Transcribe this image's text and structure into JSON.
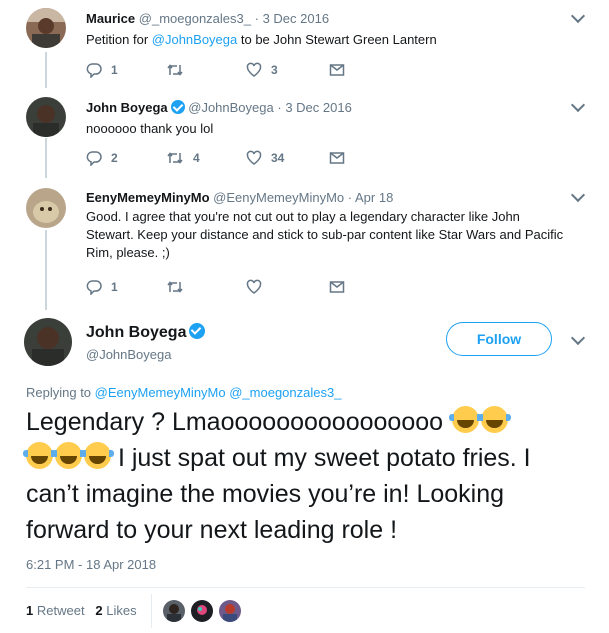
{
  "thread": [
    {
      "name": "Maurice",
      "handle": "@_moegonzales3_",
      "dot": "·",
      "date": "3 Dec 2016",
      "verified": false,
      "text_prefix": "Petition for ",
      "text_mention": "@JohnBoyega",
      "text_suffix": " to be John Stewart Green Lantern",
      "replies": "1",
      "retweets": "",
      "likes": "3"
    },
    {
      "name": "John Boyega",
      "handle": "@JohnBoyega",
      "dot": "·",
      "date": "3 Dec 2016",
      "verified": true,
      "text": "noooooo thank you lol",
      "replies": "2",
      "retweets": "4",
      "likes": "34"
    },
    {
      "name": "EenyMemeyMinyMo",
      "handle": "@EenyMemeyMinyMo",
      "dot": "·",
      "date": "Apr 18",
      "verified": false,
      "text": "Good.  I agree that you're not cut out to play a legendary character like John Stewart.  Keep your distance and stick to sub-par content like Star Wars and Pacific Rim, please.  ;)",
      "replies": "1",
      "retweets": "",
      "likes": ""
    }
  ],
  "main_tweet": {
    "name": "John Boyega",
    "handle": "@JohnBoyega",
    "follow_label": "Follow",
    "replying_prefix": "Replying to ",
    "replying_to_1": "@EenyMemeyMinyMo",
    "replying_to_2": "@_moegonzales3_",
    "text_line1": "Legendary ? Lmaoooooooooooooooo",
    "text_rest": " I just spat out my sweet potato fries. I can’t imagine the movies you’re in! Looking forward to your next leading role !",
    "timestamp": "6:21 PM - 18 Apr 2018",
    "retweet_count": "1",
    "retweet_label": "Retweet",
    "like_count": "2",
    "like_label": "Likes"
  },
  "colors": {
    "accent": "#1da1f2",
    "secondary_text": "#657786",
    "divider": "#e6ecf0"
  }
}
